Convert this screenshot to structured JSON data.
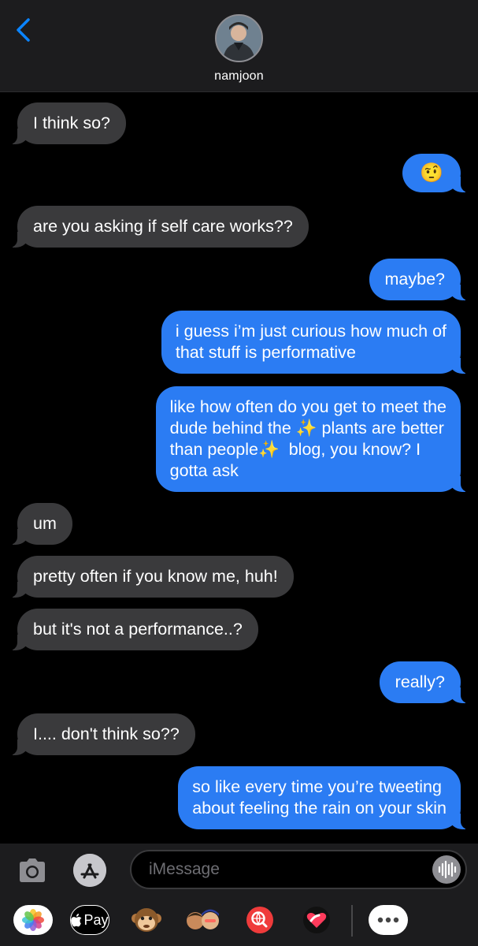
{
  "header": {
    "contact_name": "namjoon"
  },
  "messages": [
    {
      "from": "them",
      "text": "I think so?"
    },
    {
      "from": "me",
      "text": "🤨"
    },
    {
      "from": "them",
      "text": "are you asking if self care works??"
    },
    {
      "from": "me",
      "text": "maybe?"
    },
    {
      "from": "me",
      "text": "i guess i’m just curious how much of\nthat stuff is performative"
    },
    {
      "from": "me",
      "text": "like how often do you get to meet the\ndude behind the ✨ plants are better\nthan people✨  blog, you know? I\ngotta ask"
    },
    {
      "from": "them",
      "text": "um"
    },
    {
      "from": "them",
      "text": "pretty often if you know me, huh!"
    },
    {
      "from": "them",
      "text": "but it's not a performance..?"
    },
    {
      "from": "me",
      "text": "really?"
    },
    {
      "from": "them",
      "text": "I.... don't think so??"
    },
    {
      "from": "me",
      "text": "so like every time you’re tweeting\nabout feeling the rain on your skin"
    }
  ],
  "compose": {
    "placeholder": "iMessage"
  },
  "app_strip": {
    "apple_pay_label": "Pay",
    "items": [
      "photos-icon",
      "apple-pay-icon",
      "animoji-icon",
      "memoji-icon",
      "web-search-icon",
      "digital-touch-icon",
      "more-apps-icon"
    ]
  },
  "colors": {
    "outgoing_bubble": "#2b7cf3",
    "incoming_bubble": "#3a3a3c",
    "accent": "#0a84ff"
  }
}
